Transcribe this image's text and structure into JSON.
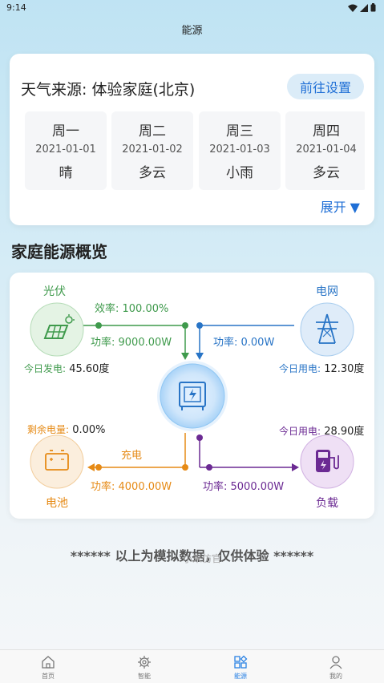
{
  "status_bar": {
    "time": "9:14"
  },
  "header": {
    "title": "能源"
  },
  "weather": {
    "title": "天气来源: 体验家庭(北京)",
    "settings_button": "前往设置",
    "expand_label": "展开 ▼",
    "days": [
      {
        "name": "周一",
        "date": "2021-01-01",
        "weather": "晴"
      },
      {
        "name": "周二",
        "date": "2021-01-02",
        "weather": "多云"
      },
      {
        "name": "周三",
        "date": "2021-01-03",
        "weather": "小雨"
      },
      {
        "name": "周四",
        "date": "2021-01-04",
        "weather": "多云"
      }
    ]
  },
  "overview": {
    "title": "家庭能源概览",
    "solar": {
      "label": "光伏",
      "today_label": "今日发电:",
      "today_value": "45.60度",
      "efficiency": "效率: 100.00%",
      "power": "功率: 9000.00W"
    },
    "grid": {
      "label": "电网",
      "today_label": "今日用电:",
      "today_value": "12.30度",
      "power": "功率: 0.00W"
    },
    "battery": {
      "label": "电池",
      "remaining_label": "剩余电量:",
      "remaining_value": "0.00%",
      "state": "充电",
      "power": "功率: 4000.00W"
    },
    "load": {
      "label": "负载",
      "today_label": "今日用电:",
      "today_value": "28.90度",
      "power": "功率: 5000.00W"
    }
  },
  "notice": "****** 以上为模拟数据，仅供体验 ******",
  "watermark": "小米仿官",
  "tabbar": {
    "items": [
      {
        "label": "首页"
      },
      {
        "label": "智能"
      },
      {
        "label": "能源"
      },
      {
        "label": "我的"
      }
    ]
  },
  "colors": {
    "accent": "#2a82e4",
    "solar": "#3f9a4c",
    "grid": "#2874c6",
    "battery": "#e68a15",
    "load": "#6b2a93"
  }
}
